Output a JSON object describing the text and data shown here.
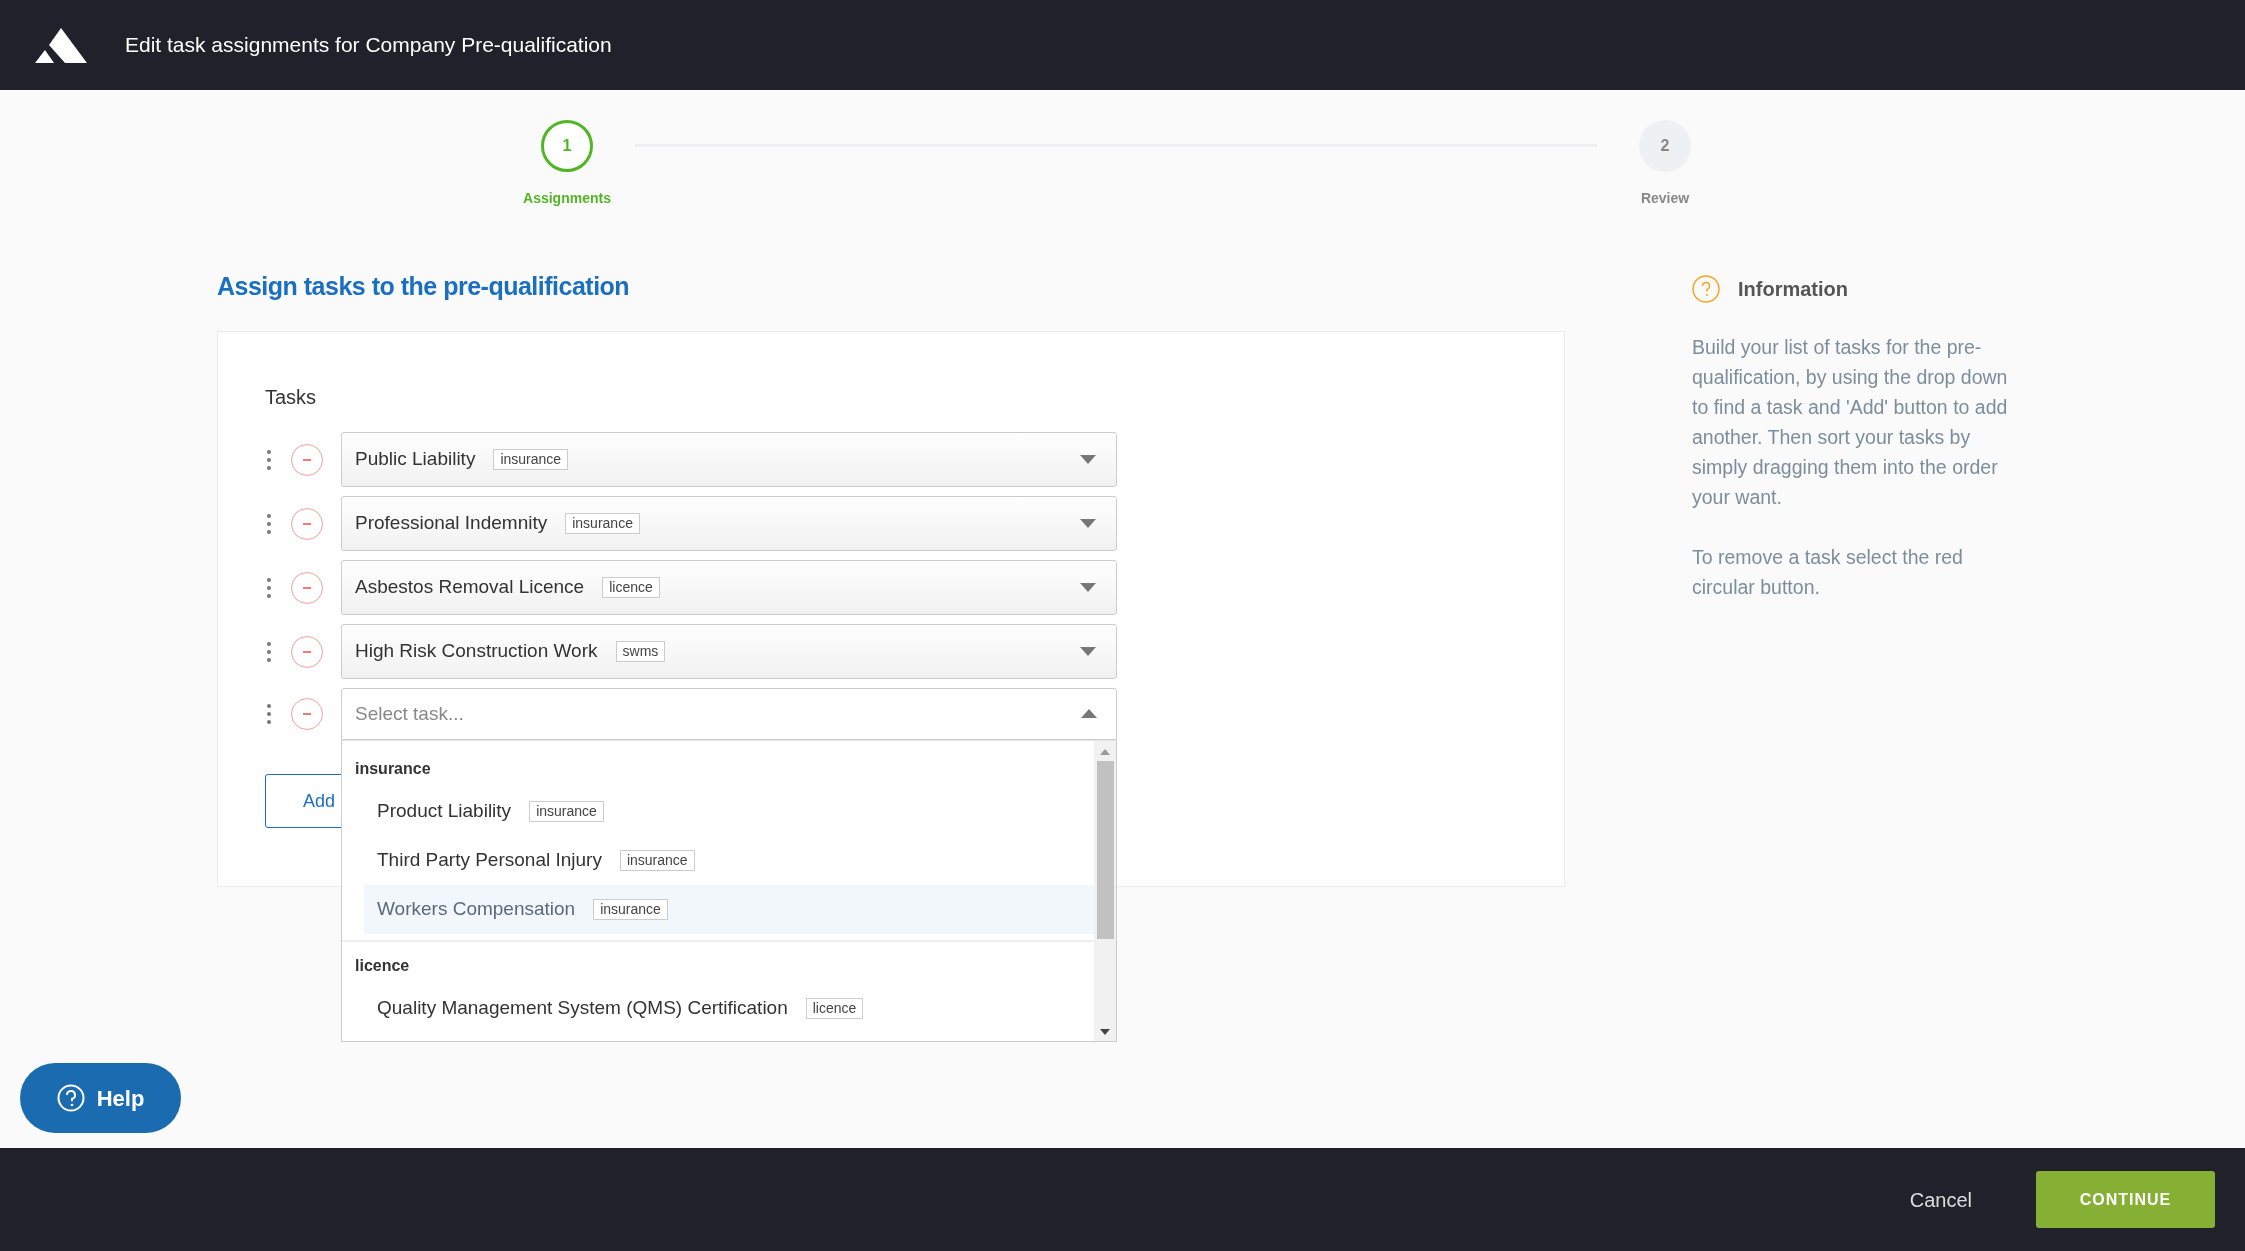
{
  "header": {
    "title": "Edit task assignments for Company Pre-qualification"
  },
  "steps": [
    {
      "number": "1",
      "label": "Assignments",
      "selected": true
    },
    {
      "number": "2",
      "label": "Review",
      "selected": false
    }
  ],
  "heading": "Assign tasks to the pre-qualification",
  "tasks_panel": {
    "title": "Tasks",
    "rows": [
      {
        "name": "Public Liability",
        "tag": "insurance"
      },
      {
        "name": "Professional Indemnity",
        "tag": "insurance"
      },
      {
        "name": "Asbestos Removal Licence",
        "tag": "licence"
      },
      {
        "name": "High Risk Construction Work",
        "tag": "swms"
      }
    ],
    "new_row": {
      "placeholder": "Select task...",
      "expanded": true
    },
    "add_button": "Add"
  },
  "dropdown": {
    "groups": [
      {
        "label": "insurance",
        "options": [
          {
            "name": "Product Liability",
            "tag": "insurance",
            "selected": false
          },
          {
            "name": "Third Party Personal Injury",
            "tag": "insurance",
            "selected": false
          },
          {
            "name": "Workers Compensation",
            "tag": "insurance",
            "selected": true
          }
        ]
      },
      {
        "label": "licence",
        "options": [
          {
            "name": "Quality Management System (QMS) Certification",
            "tag": "licence",
            "selected": false
          }
        ]
      }
    ]
  },
  "info": {
    "title": "Information",
    "paragraphs": [
      "Build your list of tasks for the pre-qualification, by using the drop down to find a task and 'Add' button to add another. Then sort your tasks by simply dragging them into the order your want.",
      "To remove a task select the red circular button."
    ]
  },
  "help_button": "Help",
  "footer": {
    "cancel": "Cancel",
    "continue": "CONTINUE"
  }
}
